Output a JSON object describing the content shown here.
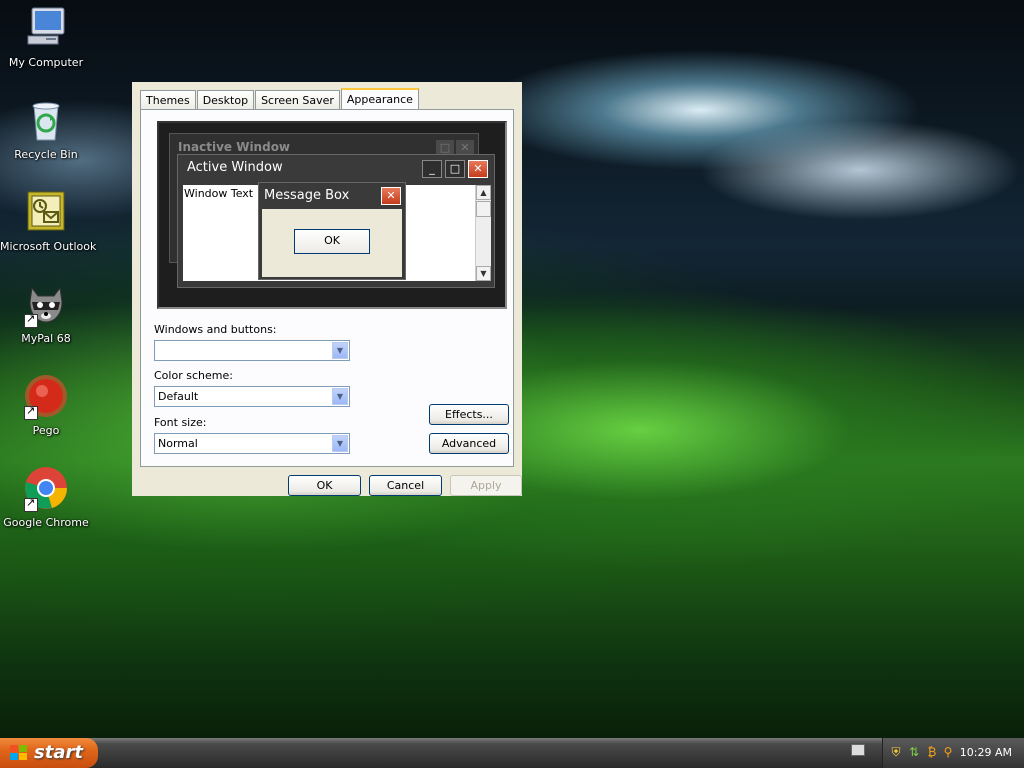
{
  "desktop": {
    "icons": [
      {
        "label": "My Computer",
        "icon": "my-computer-icon"
      },
      {
        "label": "Recycle Bin",
        "icon": "recycle-bin-icon"
      },
      {
        "label": "Microsoft Outlook",
        "icon": "outlook-icon"
      },
      {
        "label": "MyPal 68",
        "icon": "mypal-icon"
      },
      {
        "label": "Pego",
        "icon": "pego-icon"
      },
      {
        "label": "Google Chrome",
        "icon": "chrome-icon"
      }
    ]
  },
  "dialog": {
    "tabs": [
      "Themes",
      "Desktop",
      "Screen Saver",
      "Appearance"
    ],
    "active_tab": "Appearance",
    "preview": {
      "inactive_title": "Inactive Window",
      "active_title": "Active Window",
      "window_text": "Window Text",
      "message_title": "Message Box",
      "message_ok": "OK"
    },
    "windows_buttons_label": "Windows and buttons:",
    "windows_buttons_value": "",
    "color_scheme_label": "Color scheme:",
    "color_scheme_value": "Default",
    "font_size_label": "Font size:",
    "font_size_value": "Normal",
    "effects_label": "Effects...",
    "advanced_label": "Advanced",
    "ok_label": "OK",
    "cancel_label": "Cancel",
    "apply_label": "Apply"
  },
  "taskbar": {
    "start_label": "start",
    "clock": "10:29 AM",
    "tray_icons": [
      "keyboard-icon",
      "shield-icon",
      "network-icon",
      "bitcoin-icon",
      "search-icon"
    ]
  }
}
